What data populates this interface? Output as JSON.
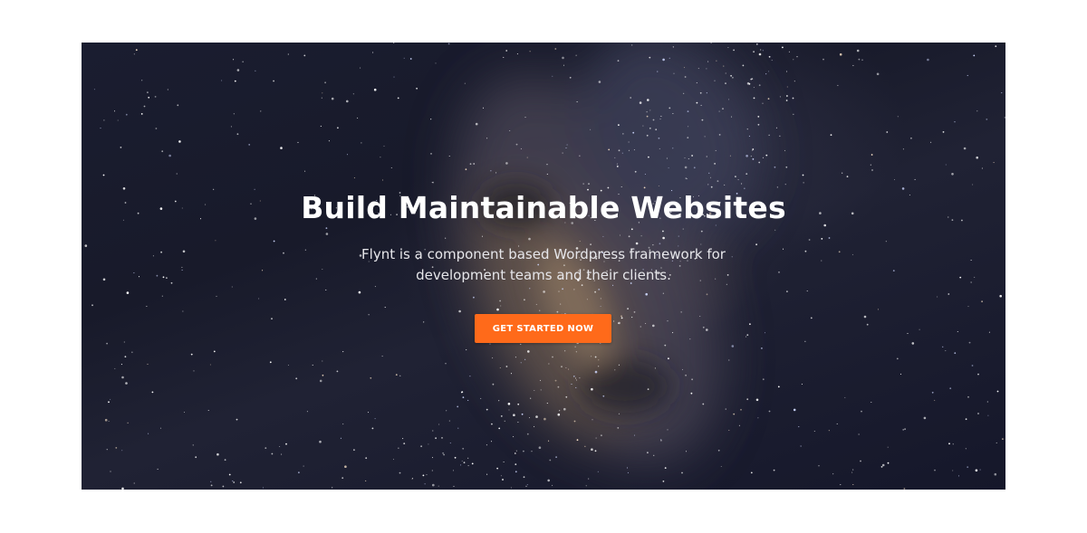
{
  "hero": {
    "title": "Build Maintainable Websites",
    "subtitle": "Flynt is a component based Wordpress framework for development teams and their clients.",
    "cta_label": "GET STARTED NOW",
    "background_image": "starry-night-sky-milky-way",
    "accent_color": "#ff6a1a"
  }
}
